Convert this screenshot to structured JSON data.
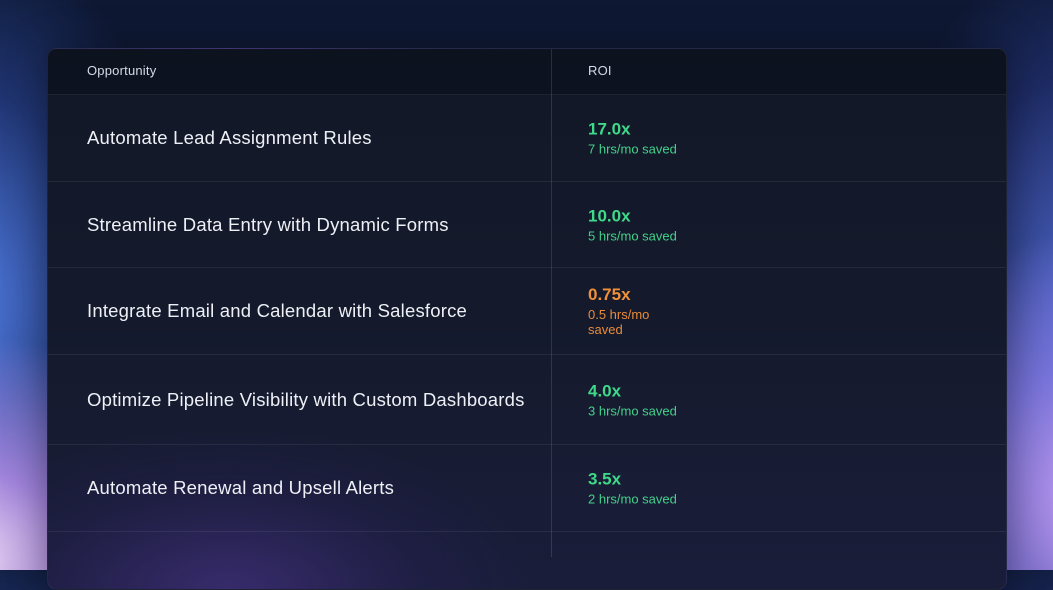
{
  "table": {
    "headers": {
      "opportunity": "Opportunity",
      "roi": "ROI"
    },
    "rows": [
      {
        "opportunity": "Automate Lead Assignment Rules",
        "roi": "17.0x",
        "saved": "7 hrs/mo saved",
        "status": "green"
      },
      {
        "opportunity": "Streamline Data Entry with Dynamic Forms",
        "roi": "10.0x",
        "saved": "5 hrs/mo saved",
        "status": "green"
      },
      {
        "opportunity": "Integrate Email and Calendar with Salesforce",
        "roi": "0.75x",
        "saved": "0.5 hrs/mo saved",
        "status": "orange"
      },
      {
        "opportunity": "Optimize Pipeline Visibility with Custom Dashboards",
        "roi": "4.0x",
        "saved": "3 hrs/mo saved",
        "status": "green"
      },
      {
        "opportunity": "Automate Renewal and Upsell Alerts",
        "roi": "3.5x",
        "saved": "2 hrs/mo saved",
        "status": "green"
      }
    ]
  },
  "colors": {
    "positive": "#3fd98a",
    "warning": "#f0913a"
  }
}
